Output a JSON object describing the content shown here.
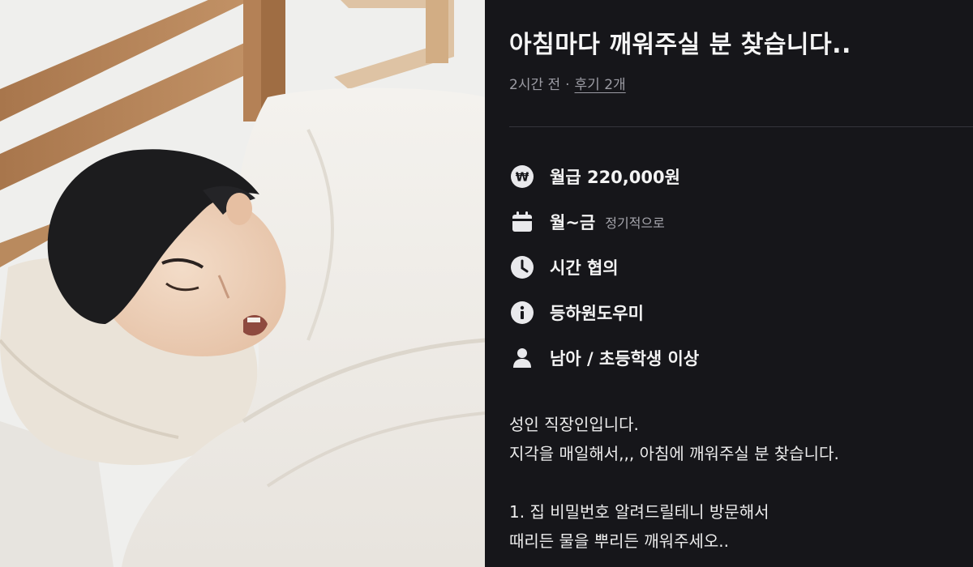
{
  "post": {
    "title": "아침마다 깨워주실 분 찾습니다..",
    "time_ago": "2시간 전",
    "separator": "·",
    "reviews": "후기 2개"
  },
  "details": [
    {
      "icon": "won-icon",
      "main": "월급 220,000원",
      "sub": ""
    },
    {
      "icon": "calendar-icon",
      "main": "월~금",
      "sub": "정기적으로"
    },
    {
      "icon": "clock-icon",
      "main": "시간 협의",
      "sub": ""
    },
    {
      "icon": "info-icon",
      "main": "등하원도우미",
      "sub": ""
    },
    {
      "icon": "person-icon",
      "main": "남아 / 초등학생 이상",
      "sub": ""
    }
  ],
  "description": {
    "line1": "성인 직장인입니다.",
    "line2": "지각을 매일해서,,, 아침에 깨워주실 분 찾습니다.",
    "line3": "1. 집 비밀번호 알려드릴테니 방문해서",
    "line4": "때리든 물을 뿌리든 깨워주세오.."
  },
  "colors": {
    "panel_bg": "#16161a",
    "icon_bg": "#e9e9ec",
    "icon_fg": "#16161a"
  }
}
